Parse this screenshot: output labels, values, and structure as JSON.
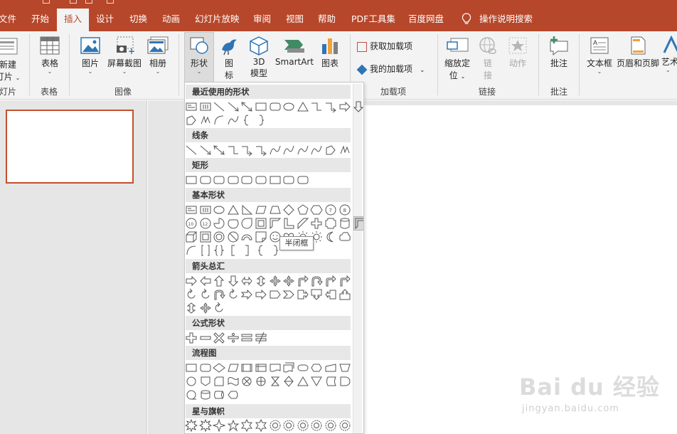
{
  "tabs": [
    "文件",
    "开始",
    "插入",
    "设计",
    "切换",
    "动画",
    "幻灯片放映",
    "审阅",
    "视图",
    "帮助",
    "PDF工具集",
    "百度网盘"
  ],
  "tell_me": "操作说明搜索",
  "ribbon": {
    "new_slide_line1": "新建",
    "new_slide_line2": "灯片",
    "table": "表格",
    "picture": "图片",
    "screenshot": "屏幕截图",
    "album": "相册",
    "shapes": "形状",
    "icons_line1": "图",
    "icons_line2": "标",
    "model_line1": "3D",
    "model_line2": "模型",
    "smartart": "SmartArt",
    "chart": "图表",
    "get_addins": "获取加载项",
    "my_addins": "我的加载项",
    "zoom_line1": "缩放定",
    "zoom_line2": "位",
    "link_line1": "链",
    "link_line2": "接",
    "action": "动作",
    "comment": "批注",
    "textbox": "文本框",
    "header_footer": "页眉和页脚",
    "wordart": "艺术"
  },
  "groups": {
    "slides": "灯片",
    "tables": "表格",
    "images": "图像",
    "addins": "加载项",
    "links": "链接",
    "comments": "批注"
  },
  "shape_gallery": {
    "categories": [
      "最近使用的形状",
      "线条",
      "矩形",
      "基本形状",
      "箭头总汇",
      "公式形状",
      "流程图",
      "星与旗帜"
    ],
    "tooltip": "半闭框"
  },
  "watermark": {
    "logo": "Bai du 经验",
    "url": "jingyan.baidu.com"
  },
  "colors": {
    "accent": "#b7472a",
    "ribbon_bg": "#f3f3f3",
    "panel_bg": "#e6e6e6",
    "thumb_border": "#c3502f"
  }
}
